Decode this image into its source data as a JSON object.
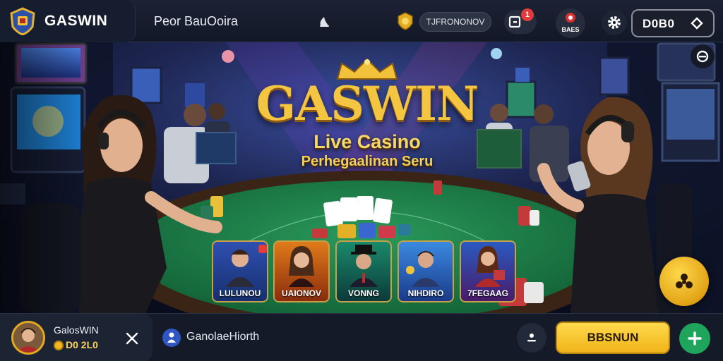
{
  "header": {
    "brand": "GASWIN",
    "title": "Peor BauOoira",
    "promo": "TJFRONONOV",
    "message_count": "1",
    "bonus_label": "BAES",
    "balance": "D0B0"
  },
  "hero": {
    "logo": "GASWIN",
    "subtitle": "Live Casino",
    "tagline": "Perhegaalinan Seru",
    "games": [
      {
        "name": "LULUNOU"
      },
      {
        "name": "UAIONOV"
      },
      {
        "name": "VONNG"
      },
      {
        "name": "NIHDIRO"
      },
      {
        "name": "7FEGAAG"
      }
    ]
  },
  "footer": {
    "username": "GalosWIN",
    "coins": "D0 2L0",
    "channel": "GanolaeHiorth",
    "play_label": "BBSNUN"
  }
}
